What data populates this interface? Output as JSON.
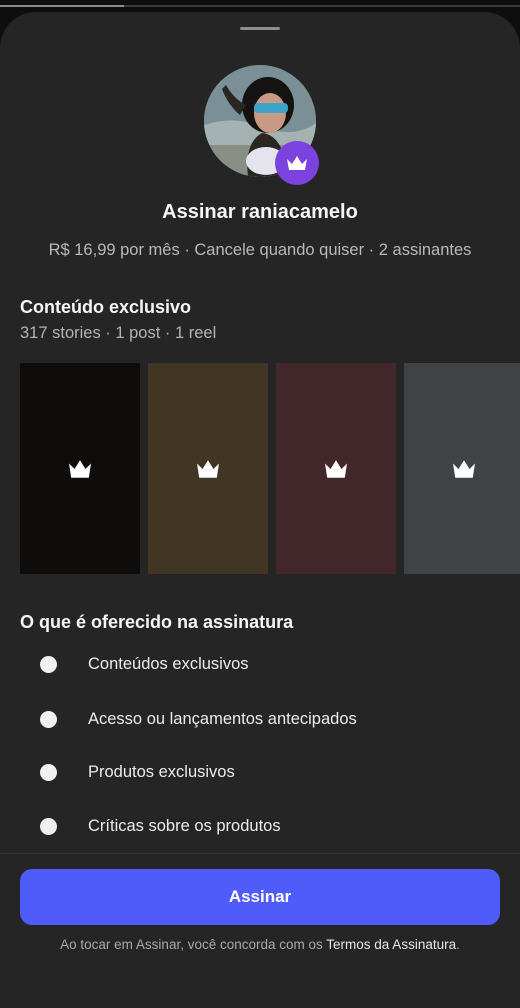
{
  "status_bar": {
    "progress": 0.24
  },
  "profile": {
    "avatar_alt": "raniacamelo",
    "badge_icon": "crown-icon",
    "badge_color": "#7b42e0"
  },
  "header": {
    "title": "Assinar raniacamelo",
    "subtitle": "R$ 16,99 por mês · Cancele quando quiser · 2 assinantes"
  },
  "exclusive_content": {
    "title": "Conteúdo exclusivo",
    "summary": "317 stories · 1 post · 1 reel",
    "tiles": [
      {
        "color": "#0e0d0c",
        "icon": "crown-icon"
      },
      {
        "color": "#413623",
        "icon": "crown-icon"
      },
      {
        "color": "#412729",
        "icon": "crown-icon"
      },
      {
        "color": "#3f4346",
        "icon": "crown-icon"
      }
    ]
  },
  "benefits": {
    "title": "O que é oferecido na assinatura",
    "items": [
      "Conteúdos exclusivos",
      "Acesso ou lançamentos antecipados",
      "Produtos exclusivos",
      "Críticas sobre os produtos"
    ]
  },
  "cta": {
    "label": "Assinar",
    "color": "#4f5cfa"
  },
  "terms": {
    "prefix": "Ao tocar em Assinar, você concorda com os ",
    "link": "Termos da Assinatura",
    "suffix": "."
  }
}
